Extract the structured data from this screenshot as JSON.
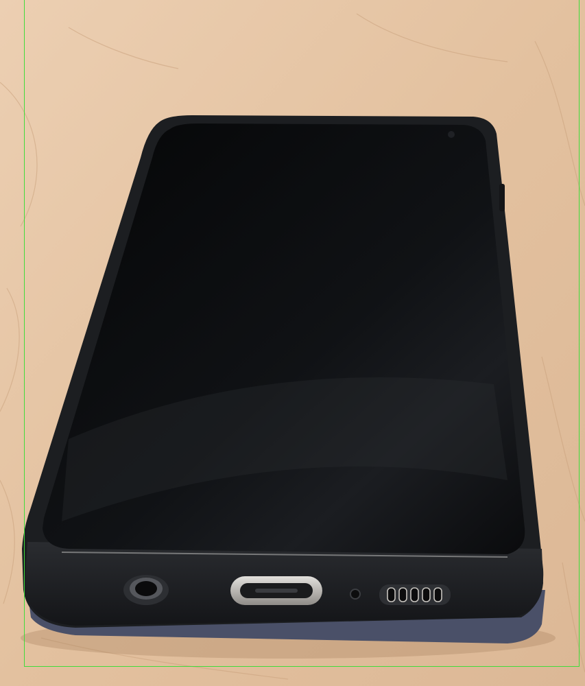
{
  "photo": {
    "subject": "smartphone",
    "colors": {
      "table": "#e4c3a3",
      "table_light": "#ecd3b8",
      "table_grain": "#caa37f",
      "case": "#1d1f22",
      "screen": "#0b0c0e",
      "back_plate": "#4a5068",
      "usb_port_ring": "#b9b6b2",
      "detection_box": "#3fdc3a"
    }
  },
  "icons": {
    "headphone_jack": "headphone-jack-icon",
    "usb_port": "usb-c-port-icon",
    "microphone": "microphone-hole-icon",
    "speaker": "speaker-grille-icon"
  }
}
